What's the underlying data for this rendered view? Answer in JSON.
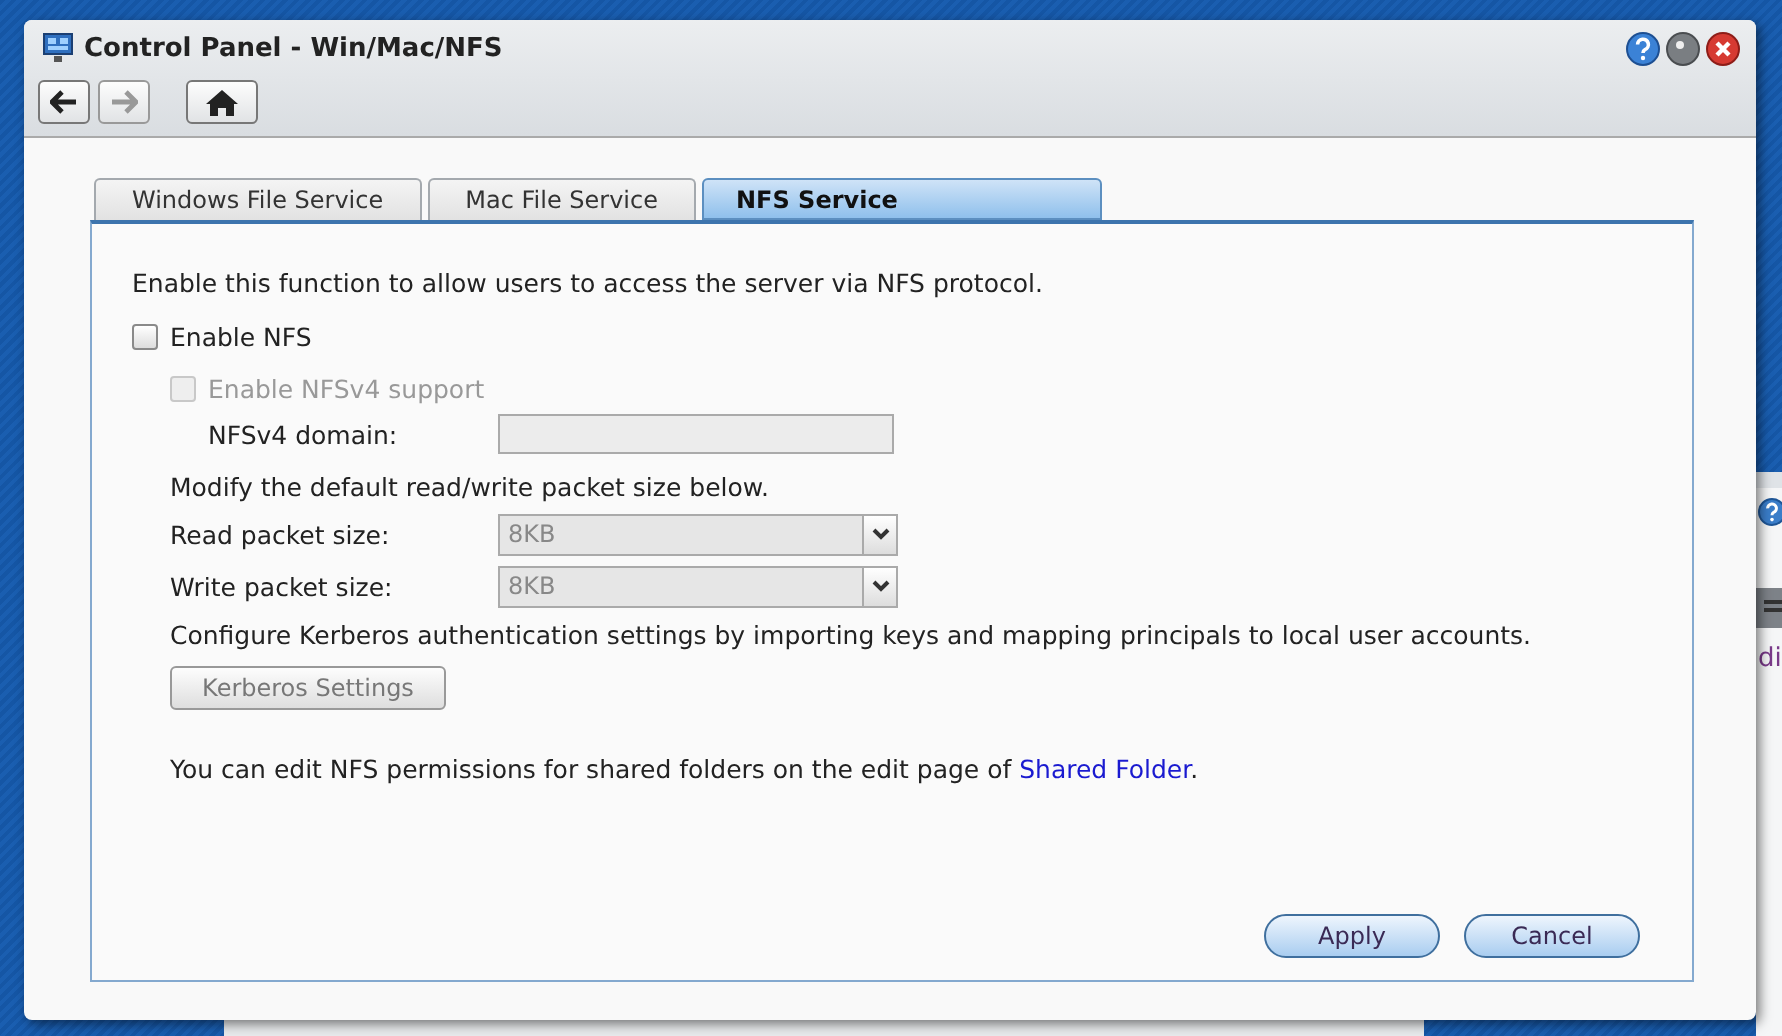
{
  "window": {
    "title": "Control Panel - Win/Mac/NFS"
  },
  "toolbar": [
    {
      "kind": "back",
      "disabled": false
    },
    {
      "kind": "forward",
      "disabled": true
    },
    {
      "kind": "home",
      "disabled": false
    }
  ],
  "tabs": [
    {
      "label": "Windows File Service",
      "selected": false
    },
    {
      "label": "Mac File Service",
      "selected": false
    },
    {
      "label": "NFS Service",
      "selected": true
    }
  ],
  "description": "Enable this function to allow users to access the server via NFS protocol.",
  "enable_nfs": {
    "label": "Enable NFS",
    "checked": false
  },
  "nfsv4": {
    "label": "Enable NFSv4 support",
    "checked": false,
    "disabled": true
  },
  "nfsv4_domain": {
    "label": "NFSv4 domain:",
    "disabled": true
  },
  "packet_note": "Modify the default read/write packet size below.",
  "packet_fields": [
    {
      "label": "Read packet size:",
      "value": "8KB",
      "disabled": true
    },
    {
      "label": "Write packet size:",
      "value": "8KB",
      "disabled": true
    }
  ],
  "kerberos_note": "Configure Kerberos authentication settings by importing keys and mapping principals to local user accounts.",
  "kerberos_button": {
    "label": "Kerberos Settings",
    "disabled": true
  },
  "footer": {
    "before": "You can edit NFS permissions for shared folders on the edit page of ",
    "link": "Shared Folder",
    "after": "."
  },
  "buttons": [
    "Apply",
    "Cancel"
  ],
  "background_window": {
    "text": "di"
  }
}
